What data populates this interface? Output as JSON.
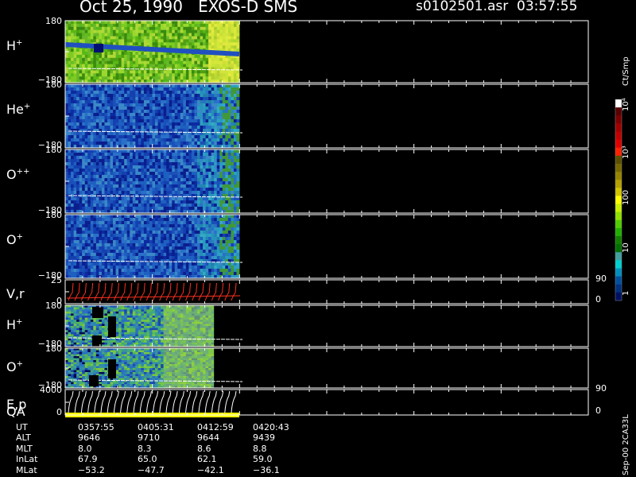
{
  "header": {
    "title_left": "Oct 25, 1990   EXOS-D SMS",
    "title_right": "s0102501.asr  03:57:55"
  },
  "colorbar": {
    "units": "Ct/Smp",
    "labels": [
      "10⁴",
      "10³",
      "100",
      "10",
      "1"
    ],
    "colors": [
      "#ffffff",
      "#5a0000",
      "#7d0000",
      "#a00000",
      "#c00000",
      "#e00000",
      "#ff2000",
      "#5a5000",
      "#786800",
      "#968400",
      "#b4a000",
      "#d2c400",
      "#ffff00",
      "#c8f000",
      "#90e000",
      "#50cc00",
      "#20b000",
      "#108000",
      "#007000",
      "#40a0a0",
      "#00d0d0",
      "#0090c0",
      "#0050a0",
      "#003080",
      "#001060"
    ]
  },
  "panels": [
    {
      "id": "h-plus",
      "label": "H",
      "sup": "+",
      "top_tick": "180",
      "bottom_tick": "−180"
    },
    {
      "id": "he-plus",
      "label": "He",
      "sup": "+",
      "top_tick": "180",
      "bottom_tick": "−180"
    },
    {
      "id": "o-plusplus",
      "label": "O",
      "sup": "++",
      "top_tick": "180",
      "bottom_tick": "−180"
    },
    {
      "id": "o-plus",
      "label": "O",
      "sup": "+",
      "top_tick": "180",
      "bottom_tick": "−180"
    },
    {
      "id": "vr",
      "label": "V,r",
      "sup": "",
      "top_tick": "25",
      "bottom_tick": "0",
      "right_top": "90",
      "right_bottom": "0"
    },
    {
      "id": "h-plus-2",
      "label": "H",
      "sup": "+",
      "top_tick": "180",
      "bottom_tick": "−180"
    },
    {
      "id": "o-plus-2",
      "label": "O",
      "sup": "+",
      "top_tick": "180",
      "bottom_tick": "−180"
    },
    {
      "id": "ep",
      "label": "E,p",
      "sup": "",
      "top_tick": "4000",
      "bottom_tick": "0",
      "right_top": "90",
      "right_bottom": "0"
    }
  ],
  "qa_label": "QA",
  "side_label": "Sep-00  2CA33L",
  "chart_data": {
    "type": "heatmap",
    "title": "Oct 25, 1990   EXOS-D SMS",
    "x_ticks": [
      "0357:55",
      "0405:31",
      "0412:59",
      "0420:43"
    ],
    "ephemeris": [
      {
        "name": "UT",
        "values": [
          "0357:55",
          "0405:31",
          "0412:59",
          "0420:43"
        ]
      },
      {
        "name": "ALT",
        "values": [
          "9646",
          "9710",
          "9644",
          "9439"
        ]
      },
      {
        "name": "MLT",
        "values": [
          "8.0",
          "8.3",
          "8.6",
          "8.8"
        ]
      },
      {
        "name": "InLat",
        "values": [
          "67.9",
          "65.0",
          "62.1",
          "59.0"
        ]
      },
      {
        "name": "MLat",
        "values": [
          "−53.2",
          "−47.7",
          "−42.1",
          "−36.1"
        ]
      }
    ]
  }
}
